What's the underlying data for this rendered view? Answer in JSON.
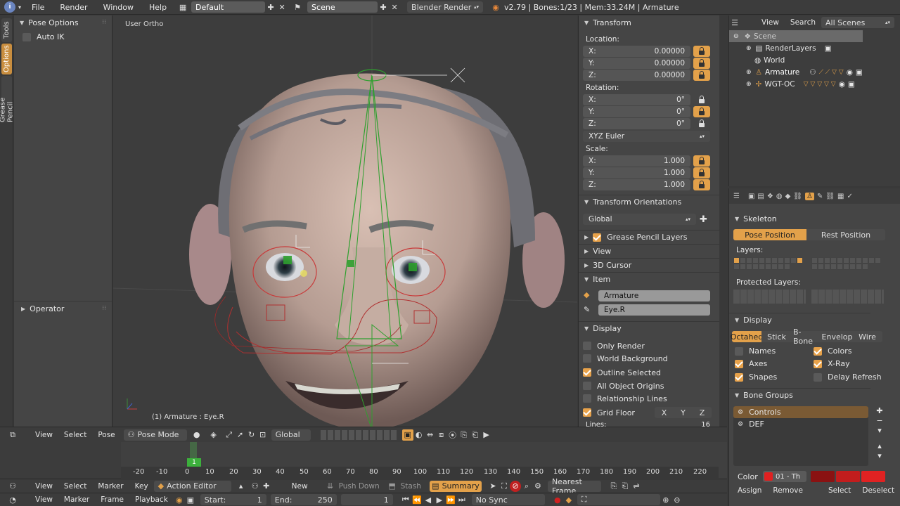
{
  "topbar": {
    "menus": [
      "File",
      "Render",
      "Window",
      "Help"
    ],
    "layout": "Default",
    "scene": "Scene",
    "engine": "Blender Render",
    "stats": "v2.79 | Bones:1/23 | Mem:33.24M | Armature"
  },
  "tool_tabs": [
    "Tools",
    "Options",
    "Grease Pencil"
  ],
  "toolshelf": {
    "pose_options_title": "Pose Options",
    "auto_ik_label": "Auto IK",
    "operator_title": "Operator"
  },
  "viewport": {
    "view_name": "User Ortho",
    "object_info": "(1) Armature : Eye.R"
  },
  "npanel": {
    "transform_title": "Transform",
    "location_label": "Location:",
    "location": [
      {
        "axis": "X:",
        "value": "0.00000"
      },
      {
        "axis": "Y:",
        "value": "0.00000"
      },
      {
        "axis": "Z:",
        "value": "0.00000"
      }
    ],
    "rotation_label": "Rotation:",
    "rotation": [
      {
        "axis": "X:",
        "value": "0°"
      },
      {
        "axis": "Y:",
        "value": "0°"
      },
      {
        "axis": "Z:",
        "value": "0°"
      }
    ],
    "rotation_mode": "XYZ Euler",
    "scale_label": "Scale:",
    "scale": [
      {
        "axis": "X:",
        "value": "1.000"
      },
      {
        "axis": "Y:",
        "value": "1.000"
      },
      {
        "axis": "Z:",
        "value": "1.000"
      }
    ],
    "transform_orientations_title": "Transform Orientations",
    "orientation": "Global",
    "grease_pencil_layers": "Grease Pencil Layers",
    "view_title": "View",
    "cursor_title": "3D Cursor",
    "item_title": "Item",
    "item_object": "Armature",
    "item_bone": "Eye.R",
    "display_title": "Display",
    "display_options": [
      {
        "label": "Only Render",
        "checked": false
      },
      {
        "label": "World Background",
        "checked": false
      },
      {
        "label": "Outline Selected",
        "checked": true
      },
      {
        "label": "All Object Origins",
        "checked": false
      },
      {
        "label": "Relationship Lines",
        "checked": false
      },
      {
        "label": "Grid Floor",
        "checked": true
      }
    ],
    "axes_buttons": [
      "X",
      "Y",
      "Z"
    ],
    "lines_label": "Lines:",
    "lines_value": "16"
  },
  "outliner": {
    "menus": [
      "View",
      "Search"
    ],
    "filter": "All Scenes",
    "items": [
      {
        "label": "Scene",
        "indent": 0
      },
      {
        "label": "RenderLayers",
        "indent": 1
      },
      {
        "label": "World",
        "indent": 1
      },
      {
        "label": "Armature",
        "indent": 1
      },
      {
        "label": "WGT-OC",
        "indent": 1
      }
    ]
  },
  "properties": {
    "skeleton_title": "Skeleton",
    "pose_position": "Pose Position",
    "rest_position": "Rest Position",
    "layers_label": "Layers:",
    "protected_layers_label": "Protected Layers:",
    "display_title": "Display",
    "display_types": [
      "Octahed",
      "Stick",
      "B-Bone",
      "Envelop",
      "Wire"
    ],
    "display_checks": [
      {
        "label": "Names",
        "checked": false
      },
      {
        "label": "Colors",
        "checked": true
      },
      {
        "label": "Axes",
        "checked": true
      },
      {
        "label": "X-Ray",
        "checked": true
      },
      {
        "label": "Shapes",
        "checked": true
      },
      {
        "label": "Delay Refresh",
        "checked": false
      }
    ],
    "bone_groups_title": "Bone Groups",
    "bone_groups": [
      "Controls",
      "DEF"
    ],
    "color_label": "Color",
    "color_set": "01 - Th",
    "buttons": [
      "Assign",
      "Remove",
      "Select",
      "Deselect"
    ]
  },
  "viewport_header": {
    "menus": [
      "View",
      "Select",
      "Pose"
    ],
    "mode": "Pose Mode",
    "orientation": "Global"
  },
  "timeline": {
    "ticks": [
      "-20",
      "-10",
      "0",
      "10",
      "20",
      "30",
      "40",
      "50",
      "60",
      "70",
      "80",
      "90",
      "100",
      "110",
      "120",
      "130",
      "140",
      "150",
      "160",
      "170",
      "180",
      "190",
      "200",
      "210",
      "220"
    ],
    "current_frame": "1"
  },
  "action_header": {
    "menus": [
      "View",
      "Select",
      "Marker",
      "Key"
    ],
    "editor": "Action Editor",
    "new_label": "New",
    "push_down": "Push Down",
    "stash": "Stash",
    "summary": "Summary",
    "snap": "Nearest Frame"
  },
  "timeline_header": {
    "menus": [
      "View",
      "Marker",
      "Frame",
      "Playback"
    ],
    "start_label": "Start:",
    "start_value": "1",
    "end_label": "End:",
    "end_value": "250",
    "frame_value": "1",
    "sync": "No Sync"
  },
  "colors": {
    "accent": "#e3a14a",
    "panel": "#454545",
    "viewport": "#3d3d3d",
    "bone_green": "#2fa02f",
    "bone_red": "#c83a3a"
  }
}
